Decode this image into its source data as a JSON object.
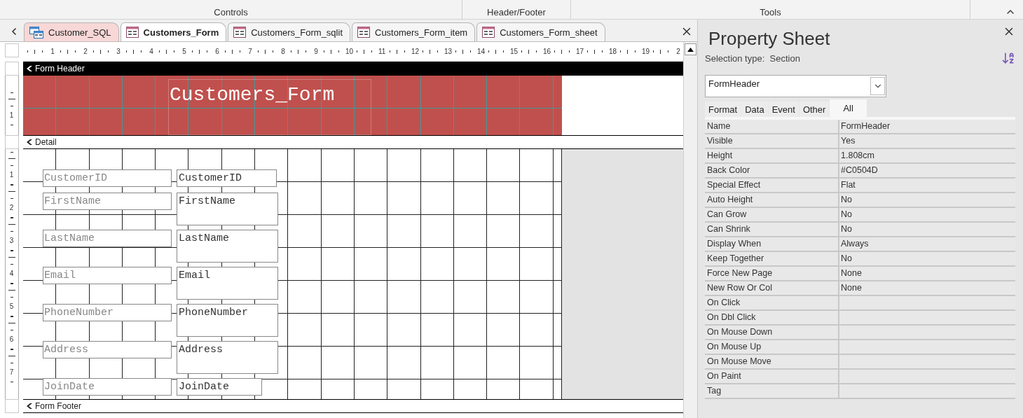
{
  "ribbon_groups": [
    "Controls",
    "Header/Footer",
    "Tools"
  ],
  "document_tabs": [
    {
      "label": "Customer_SQL",
      "kind": "query",
      "selected": false
    },
    {
      "label": "Customers_Form",
      "kind": "form",
      "selected": true
    },
    {
      "label": "Customers_Form_sqlit",
      "kind": "form",
      "selected": false
    },
    {
      "label": "Customers_Form_item",
      "kind": "form",
      "selected": false
    },
    {
      "label": "Customers_Form_sheet",
      "kind": "form",
      "selected": false
    }
  ],
  "horizontal_ruler": [
    "1",
    "2",
    "3",
    "4",
    "5",
    "6",
    "7",
    "8",
    "9",
    "10",
    "11",
    "12",
    "13",
    "14",
    "15",
    "16",
    "17",
    "18",
    "19",
    "2"
  ],
  "form_header": {
    "label": "Form Header",
    "selected": true,
    "ruler": [
      "1"
    ],
    "title": "Customers_Form"
  },
  "detail": {
    "label": "Detail",
    "selected": false,
    "ruler": [
      "1",
      "2",
      "3",
      "4",
      "5",
      "6",
      "7"
    ],
    "fields": [
      {
        "label": "CustomerID",
        "textbox": "CustomerID",
        "kind": "single"
      },
      {
        "label": "FirstName",
        "textbox": "FirstName",
        "kind": "multi"
      },
      {
        "label": "LastName",
        "textbox": "LastName",
        "kind": "multi"
      },
      {
        "label": "Email",
        "textbox": "Email",
        "kind": "multi"
      },
      {
        "label": "PhoneNumber",
        "textbox": "PhoneNumber",
        "kind": "multi"
      },
      {
        "label": "Address",
        "textbox": "Address",
        "kind": "multi"
      },
      {
        "label": "JoinDate",
        "textbox": "JoinDate",
        "kind": "short"
      }
    ]
  },
  "form_footer": {
    "label": "Form Footer",
    "selected": false
  },
  "property_sheet": {
    "title": "Property Sheet",
    "selection_type_label": "Selection type:",
    "selection_type": "Section",
    "selector": "FormHeader",
    "tabs": [
      {
        "label": "Format",
        "selected": false
      },
      {
        "label": "Data",
        "selected": false
      },
      {
        "label": "Event",
        "selected": false
      },
      {
        "label": "Other",
        "selected": false
      },
      {
        "label": "All",
        "selected": true
      }
    ],
    "properties": [
      {
        "name": "Name",
        "value": "FormHeader"
      },
      {
        "name": "Visible",
        "value": "Yes"
      },
      {
        "name": "Height",
        "value": "1.808cm"
      },
      {
        "name": "Back Color",
        "value": "#C0504D"
      },
      {
        "name": "Special Effect",
        "value": "Flat"
      },
      {
        "name": "Auto Height",
        "value": "No"
      },
      {
        "name": "Can Grow",
        "value": "No"
      },
      {
        "name": "Can Shrink",
        "value": "No"
      },
      {
        "name": "Display When",
        "value": "Always"
      },
      {
        "name": "Keep Together",
        "value": "No"
      },
      {
        "name": "Force New Page",
        "value": "None"
      },
      {
        "name": "New Row Or Col",
        "value": "None"
      },
      {
        "name": "On Click"
      },
      {
        "name": "On Dbl Click"
      },
      {
        "name": "On Mouse Down"
      },
      {
        "name": "On Mouse Up"
      },
      {
        "name": "On Mouse Move"
      },
      {
        "name": "On Paint"
      },
      {
        "name": "Tag"
      }
    ]
  }
}
